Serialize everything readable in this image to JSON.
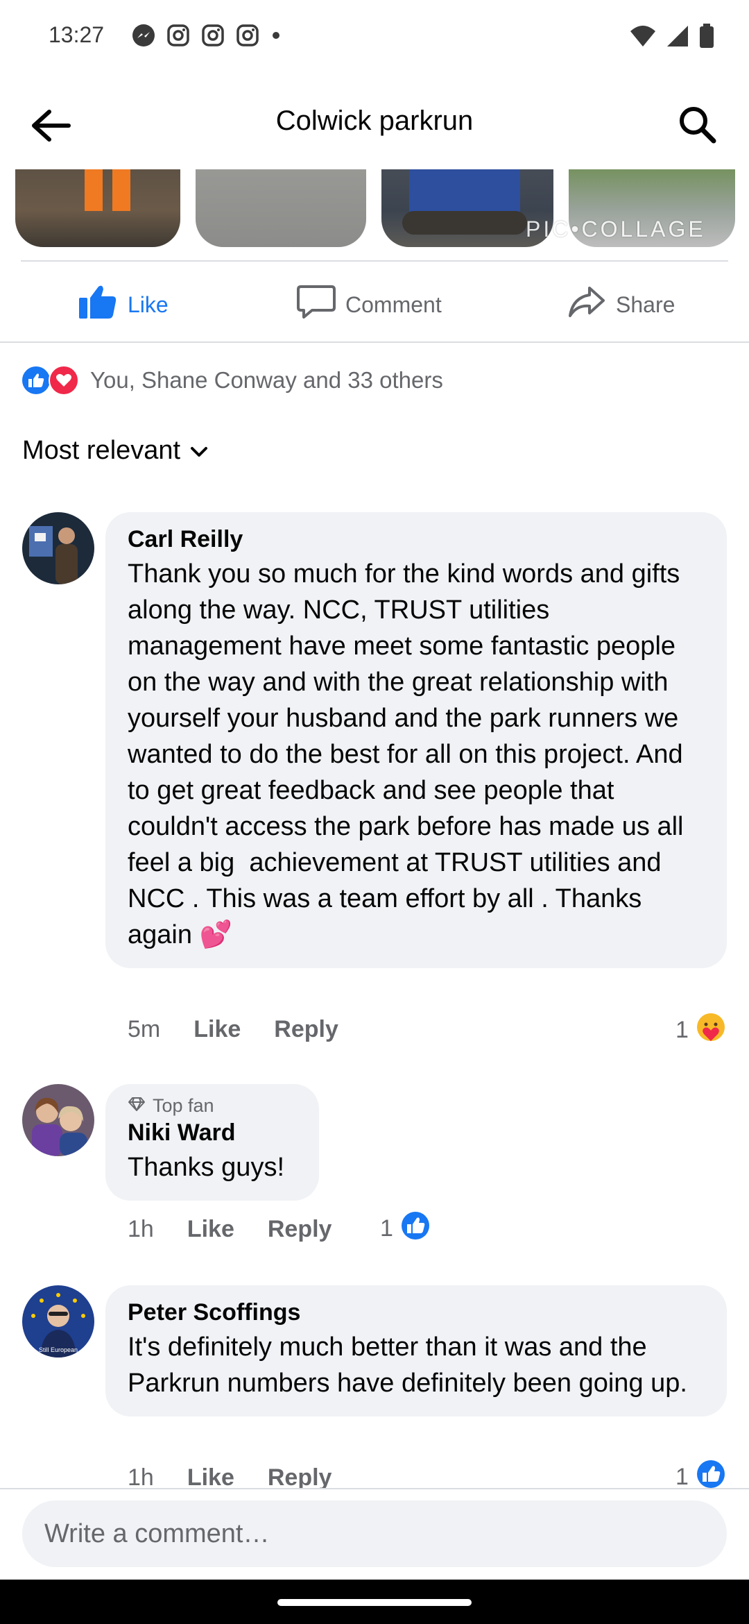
{
  "status_bar": {
    "time": "13:27",
    "notification_icons": [
      "messenger-icon",
      "instagram-icon",
      "instagram-icon",
      "instagram-icon",
      "dot-icon"
    ],
    "system_icons": [
      "wifi-icon",
      "signal-icon",
      "battery-icon"
    ]
  },
  "header": {
    "title": "Colwick parkrun",
    "back_icon": "arrow-left-icon",
    "search_icon": "search-icon"
  },
  "photo_strip": {
    "watermark": "PIC•COLLAGE"
  },
  "actions": {
    "like_label": "Like",
    "comment_label": "Comment",
    "share_label": "Share"
  },
  "reactions": {
    "summary": "You, Shane Conway and 33 others",
    "icons": [
      "like-reaction-icon",
      "love-reaction-icon"
    ]
  },
  "sort": {
    "label": "Most relevant"
  },
  "comments": [
    {
      "author": "Carl Reilly",
      "text": "Thank you so much for the kind words and gifts along the way. NCC, TRUST utilities management have meet some fantastic people on the way and with the great relationship with yourself your husband and the park runners we wanted to do the best for all on this project. And to get great feedback and see people that couldn't access the park before has made us all feel a big  achievement at TRUST utilities and NCC . This was a team effort by all . Thanks again 💕",
      "time": "5m",
      "like_label": "Like",
      "reply_label": "Reply",
      "reaction_count": "1",
      "reaction_icon": "care-reaction-icon"
    },
    {
      "badge": "Top fan",
      "author": "Niki Ward",
      "text": "Thanks guys!",
      "time": "1h",
      "like_label": "Like",
      "reply_label": "Reply",
      "reaction_count": "1",
      "reaction_icon": "like-reaction-icon"
    },
    {
      "author": "Peter Scoffings",
      "avatar_text": "Still European",
      "text": "It's definitely much better than it was and the Parkrun numbers have definitely been going up.",
      "time": "1h",
      "like_label": "Like",
      "reply_label": "Reply",
      "reaction_count": "1",
      "reaction_icon": "like-reaction-icon"
    }
  ],
  "composer": {
    "placeholder": "Write a comment…"
  },
  "colors": {
    "facebook_blue": "#1877f2",
    "bubble_bg": "#f0f2f5",
    "secondary_text": "#65676b",
    "love_red": "#f02849"
  }
}
